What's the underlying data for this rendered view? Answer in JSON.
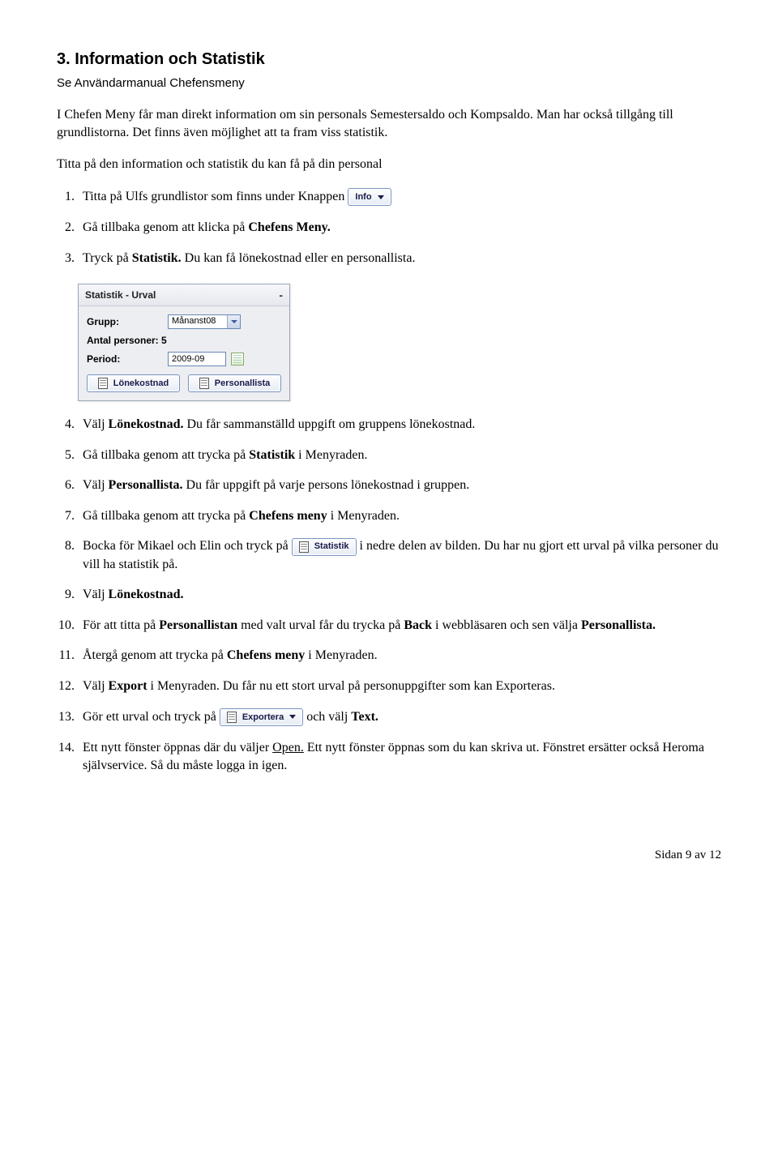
{
  "heading": "3.   Information och Statistik",
  "subheading": "Se Användarmanual Chefensmeny",
  "intro1": "I Chefen Meny får man direkt information om sin personals Semestersaldo och Kompsaldo. Man har också tillgång till grundlistorna. Det finns även möjlighet att ta fram viss statistik.",
  "intro2": "Titta på den information och statistik du kan få på din personal",
  "buttons": {
    "info": "Info",
    "statistik": "Statistik",
    "exportera": "Exportera",
    "lonekostnad": "Lönekostnad",
    "personallista": "Personallista"
  },
  "panel": {
    "title": "Statistik - Urval",
    "grupp_label": "Grupp:",
    "grupp_value": "Månanst08",
    "antal_label": "Antal personer: 5",
    "period_label": "Period:",
    "period_value": "2009-09"
  },
  "steps": {
    "s1a": "Titta på Ulfs grundlistor som finns under Knappen ",
    "s2": "Gå tillbaka genom att klicka på ",
    "s2b": "Chefens Meny.",
    "s3a": "Tryck på ",
    "s3b": "Statistik.",
    "s3c": " Du kan få lönekostnad eller en personallista.",
    "s4a": "Välj ",
    "s4b": "Lönekostnad.",
    "s4c": " Du får sammanställd uppgift om gruppens lönekostnad.",
    "s5a": "Gå tillbaka genom att trycka på ",
    "s5b": "Statistik",
    "s5c": " i Menyraden.",
    "s6a": "Välj ",
    "s6b": "Personallista.",
    "s6c": " Du får uppgift på varje persons lönekostnad i gruppen.",
    "s7a": "Gå tillbaka genom att trycka på ",
    "s7b": "Chefens meny",
    "s7c": " i Menyraden.",
    "s8a": "Bocka för Mikael och Elin och tryck på ",
    "s8b": " i nedre delen av bilden. Du har nu gjort ett urval på vilka personer du vill ha statistik på.",
    "s9a": "Välj ",
    "s9b": "Lönekostnad.",
    "s10a": "För att titta på ",
    "s10b": "Personallistan",
    "s10c": " med valt urval får du trycka på ",
    "s10d": "Back",
    "s10e": " i webbläsaren och sen välja ",
    "s10f": "Personallista.",
    "s11a": "Återgå genom att trycka på ",
    "s11b": "Chefens meny",
    "s11c": " i Menyraden.",
    "s12a": "Välj ",
    "s12b": "Export",
    "s12c": " i Menyraden. Du får nu ett stort urval på personuppgifter som kan Exporteras.",
    "s13a": "Gör ett urval och tryck på  ",
    "s13b": " och välj ",
    "s13c": "Text.",
    "s14a": "Ett nytt fönster öppnas där du väljer ",
    "s14b": "Open.",
    "s14c": " Ett nytt fönster öppnas som du kan skriva ut. Fönstret ersätter också Heroma självservice. Så du måste logga in igen."
  },
  "footer": "Sidan 9 av 12"
}
